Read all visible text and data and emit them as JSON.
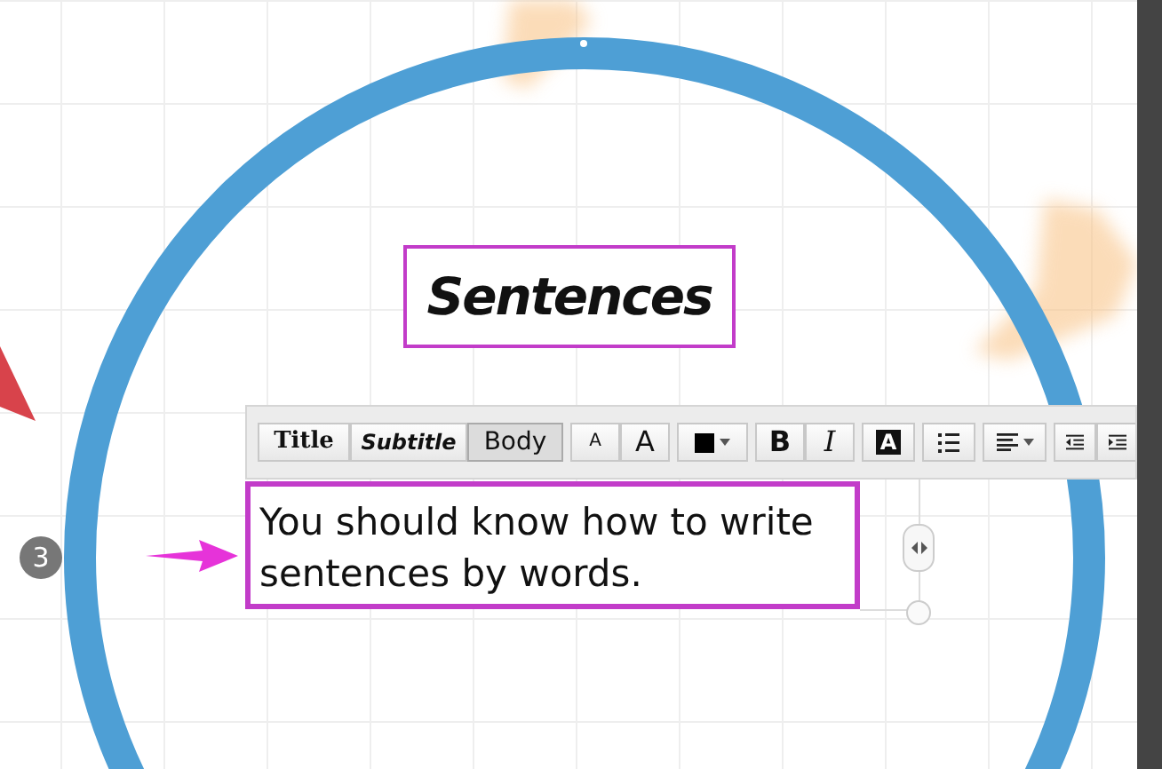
{
  "canvas": {
    "title": "Sentences",
    "step_number": "3"
  },
  "toolbar": {
    "styles": [
      {
        "label": "Title",
        "kind": "title",
        "selected": false
      },
      {
        "label": "Subtitle",
        "kind": "subtitle",
        "selected": false
      },
      {
        "label": "Body",
        "kind": "body",
        "selected": true
      }
    ],
    "size_buttons": [
      "A",
      "A"
    ],
    "format_buttons": [
      "B",
      "I"
    ],
    "highlight_button": "A"
  },
  "text_box": {
    "text": "You should know how to write sentences by words."
  }
}
